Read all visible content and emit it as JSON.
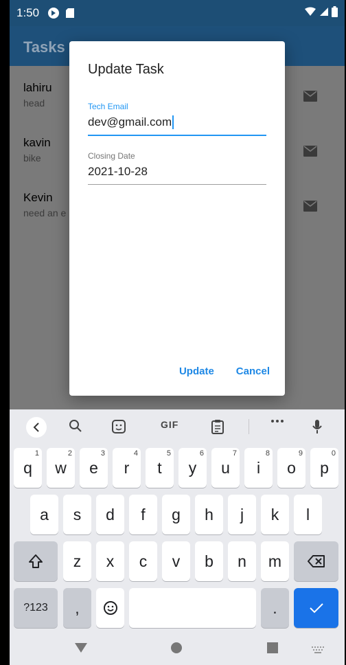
{
  "status_bar": {
    "time": "1:50"
  },
  "app_bar": {
    "title": "Tasks"
  },
  "tasks": [
    {
      "title": "lahiru",
      "subtitle": "head"
    },
    {
      "title": "kavin",
      "subtitle": "bike"
    },
    {
      "title": "Kevin",
      "subtitle": "need an e"
    }
  ],
  "dialog": {
    "title": "Update Task",
    "fields": [
      {
        "label": "Tech Email",
        "value": "dev@gmail.com"
      },
      {
        "label": "Closing Date",
        "value": "2021-10-28"
      }
    ],
    "update_label": "Update",
    "cancel_label": "Cancel"
  },
  "keyboard": {
    "suggestion_gif": "GIF",
    "row1": [
      {
        "key": "q",
        "hint": "1"
      },
      {
        "key": "w",
        "hint": "2"
      },
      {
        "key": "e",
        "hint": "3"
      },
      {
        "key": "r",
        "hint": "4"
      },
      {
        "key": "t",
        "hint": "5"
      },
      {
        "key": "y",
        "hint": "6"
      },
      {
        "key": "u",
        "hint": "7"
      },
      {
        "key": "i",
        "hint": "8"
      },
      {
        "key": "o",
        "hint": "9"
      },
      {
        "key": "p",
        "hint": "0"
      }
    ],
    "row2": [
      "a",
      "s",
      "d",
      "f",
      "g",
      "h",
      "j",
      "k",
      "l"
    ],
    "row3": [
      "z",
      "x",
      "c",
      "v",
      "b",
      "n",
      "m"
    ],
    "symbols_label": "?123",
    "comma_label": ",",
    "period_label": "."
  },
  "colors": {
    "accent": "#2196f3",
    "app_bar": "#1e507a",
    "enter_key": "#1a73e8"
  }
}
